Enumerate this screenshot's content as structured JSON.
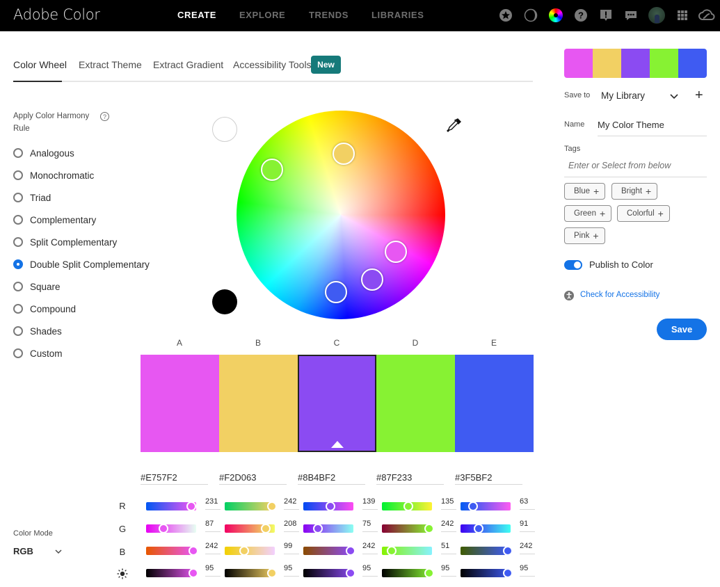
{
  "header": {
    "brand": "Adobe Color",
    "nav": [
      {
        "label": "CREATE",
        "active": true
      },
      {
        "label": "EXPLORE",
        "active": false
      },
      {
        "label": "TRENDS",
        "active": false
      },
      {
        "label": "LIBRARIES",
        "active": false
      }
    ],
    "icons": [
      "star-icon",
      "moon-icon",
      "color-wheel-icon",
      "help-icon",
      "feedback-icon",
      "chat-icon",
      "user-avatar",
      "apps-grid-icon",
      "creative-cloud-icon"
    ]
  },
  "tabs": {
    "items": [
      "Color Wheel",
      "Extract Theme",
      "Extract Gradient",
      "Accessibility Tools"
    ],
    "active": "Color Wheel",
    "new_badge": "New"
  },
  "harmony": {
    "title": "Apply Color Harmony Rule",
    "help": "?",
    "rules": [
      "Analogous",
      "Monochromatic",
      "Triad",
      "Complementary",
      "Split Complementary",
      "Double Split Complementary",
      "Square",
      "Compound",
      "Shades",
      "Custom"
    ],
    "selected": "Double Split Complementary"
  },
  "swatches": [
    {
      "label": "A",
      "hex": "#E757F2",
      "r": 231,
      "g": 87,
      "b": 242,
      "brightness": 95
    },
    {
      "label": "B",
      "hex": "#F2D063",
      "r": 242,
      "g": 208,
      "b": 99,
      "brightness": 95
    },
    {
      "label": "C",
      "hex": "#8B4BF2",
      "r": 139,
      "g": 75,
      "b": 242,
      "brightness": 95
    },
    {
      "label": "D",
      "hex": "#87F233",
      "r": 135,
      "g": 242,
      "b": 51,
      "brightness": 95
    },
    {
      "label": "E",
      "hex": "#3F5BF2",
      "r": 63,
      "g": 91,
      "b": 242,
      "brightness": 95
    }
  ],
  "selected_swatch": "C",
  "channels": [
    "R",
    "G",
    "B"
  ],
  "color_mode": {
    "label": "Color Mode",
    "value": "RGB"
  },
  "right_panel": {
    "save_to_label": "Save to",
    "save_to_value": "My Library",
    "add": "+",
    "name_label": "Name",
    "name_value": "My Color Theme",
    "tags_label": "Tags",
    "tags_placeholder": "Enter or Select from below",
    "tags": [
      "Blue",
      "Bright",
      "Green",
      "Colorful",
      "Pink"
    ],
    "publish_label": "Publish to Color",
    "publish_on": true,
    "accessibility_link": "Check for Accessibility",
    "save_button": "Save"
  }
}
